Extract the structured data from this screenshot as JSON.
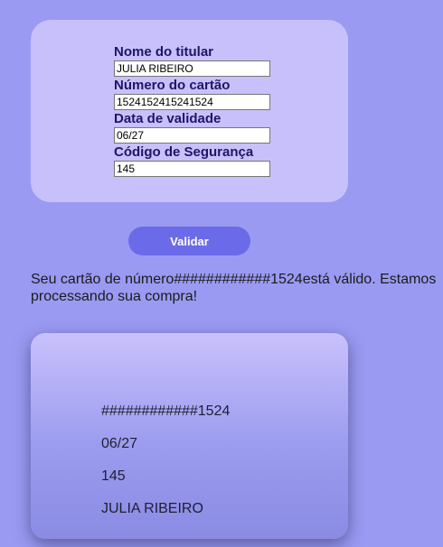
{
  "form": {
    "holder_label": "Nome do titular",
    "holder_value": "JULIA RIBEIRO",
    "number_label": "Número do cartão",
    "number_value": "1524152415241524",
    "expiry_label": "Data de validade",
    "expiry_value": "06/27",
    "cvv_label": "Código de Segurança",
    "cvv_value": "145"
  },
  "validate_button": "Validar",
  "status_message": "Seu cartão de número############1524está válido. Estamos processando sua compra!",
  "card_preview": {
    "masked_number": "############1524",
    "expiry": "06/27",
    "cvv": "145",
    "holder": "JULIA RIBEIRO"
  }
}
